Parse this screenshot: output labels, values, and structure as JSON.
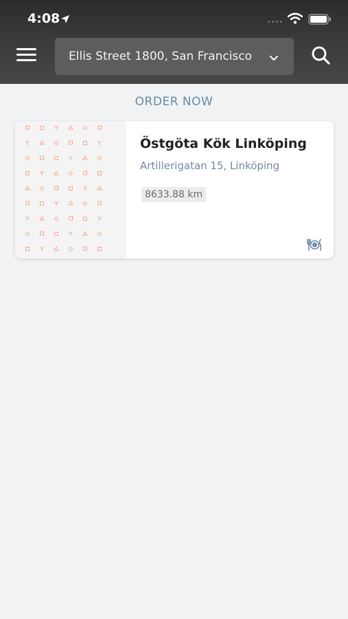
{
  "status_bar": {
    "time": "4:08",
    "icons": [
      "location-arrow-icon",
      "signal-icon",
      "wifi-icon",
      "battery-icon"
    ]
  },
  "header": {
    "menu_icon": "hamburger-menu-icon",
    "address": "Ellis Street 1800, San Francisco...",
    "dropdown_icon": "chevron-down-icon",
    "search_icon": "search-icon"
  },
  "section": {
    "title": "ORDER NOW"
  },
  "restaurants": [
    {
      "name": "Östgöta Kök Linköping",
      "address": "Artillerigatan 15, Linköping",
      "distance": "8633.88 km",
      "service_icon": "dine-in-icon"
    }
  ],
  "colors": {
    "header_bg": "#3a3a3a",
    "address_bg": "#5d5d5d",
    "page_bg": "#f0f2f4",
    "accent": "#6f8ba6",
    "pattern": "#f3a88a"
  }
}
